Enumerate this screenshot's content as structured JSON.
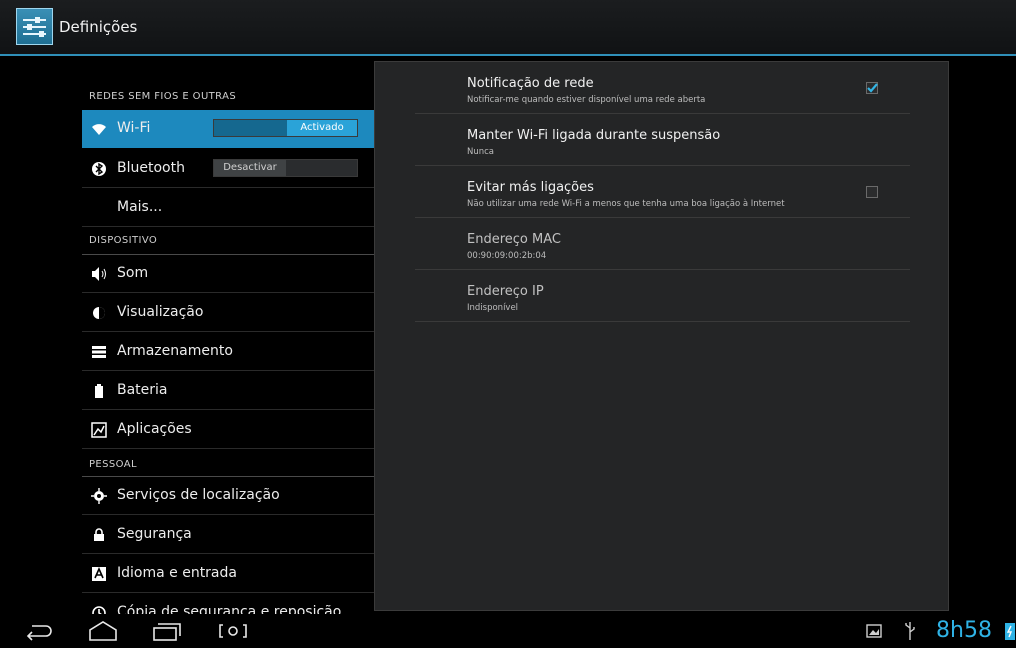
{
  "app": {
    "title": "Definições"
  },
  "left_panel": {
    "categories": [
      {
        "label": "REDES SEM FIOS E OUTRAS"
      },
      {
        "label": "DISPOSITIVO"
      },
      {
        "label": "PESSOAL"
      }
    ],
    "items": [
      {
        "label": "Wi-Fi",
        "icon": "wifi-icon",
        "selected": true,
        "toggle": {
          "label": "Activado",
          "state": "on"
        }
      },
      {
        "label": "Bluetooth",
        "icon": "bluetooth-icon",
        "toggle": {
          "label": "Desactivar",
          "state": "off"
        }
      },
      {
        "label": "Mais...",
        "icon": ""
      },
      {
        "label": "Som",
        "icon": "sound-icon"
      },
      {
        "label": "Visualização",
        "icon": "display-icon"
      },
      {
        "label": "Armazenamento",
        "icon": "storage-icon"
      },
      {
        "label": "Bateria",
        "icon": "battery-icon"
      },
      {
        "label": "Aplicações",
        "icon": "apps-icon"
      },
      {
        "label": "Serviços de localização",
        "icon": "location-icon"
      },
      {
        "label": "Segurança",
        "icon": "lock-icon"
      },
      {
        "label": "Idioma e entrada",
        "icon": "language-icon"
      },
      {
        "label": "Cópia de segurança e reposição",
        "icon": "backup-icon"
      }
    ]
  },
  "right_panel": {
    "prefs": [
      {
        "title": "Notificação de rede",
        "summary": "Notificar-me quando estiver disponível uma rede aberta",
        "checkbox": true,
        "checked": true
      },
      {
        "title": "Manter Wi-Fi ligada durante suspensão",
        "summary": "Nunca"
      },
      {
        "title": "Evitar más ligações",
        "summary": "Não utilizar uma rede Wi-Fi a menos que tenha uma boa ligação à Internet",
        "checkbox": true,
        "checked": false
      },
      {
        "title": "Endereço MAC",
        "summary": "00:90:09:00:2b:04"
      },
      {
        "title": "Endereço IP",
        "summary": "Indisponível"
      }
    ]
  },
  "status_bar": {
    "time": "8h58",
    "icons": [
      "gallery-icon",
      "usb-icon",
      "battery-charging-icon"
    ]
  },
  "nav_buttons": [
    "back-icon",
    "home-icon",
    "recent-apps-icon",
    "screenshot-icon"
  ],
  "colors": {
    "accent": "#1d89be",
    "clock": "#2fb3e6",
    "background": "#000000"
  }
}
